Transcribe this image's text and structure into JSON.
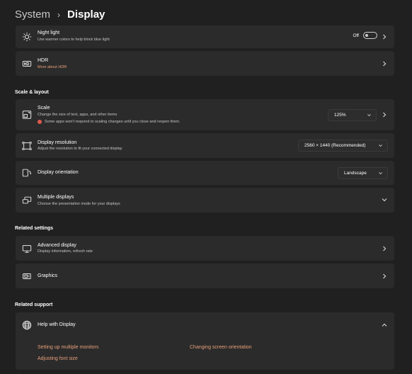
{
  "breadcrumb": {
    "parent": "System",
    "separator": "›",
    "current": "Display"
  },
  "night_light": {
    "title": "Night light",
    "subtitle": "Use warmer colors to help block blue light",
    "toggle_label": "Off"
  },
  "hdr": {
    "title": "HDR",
    "link": "More about HDR"
  },
  "scale_layout": {
    "heading": "Scale & layout",
    "scale": {
      "title": "Scale",
      "subtitle": "Change the size of text, apps, and other items",
      "warning": "Some apps won't respond to scaling changes until you close and reopen them.",
      "value": "125%"
    },
    "resolution": {
      "title": "Display resolution",
      "subtitle": "Adjust the resolution to fit your connected display",
      "value": "2560 × 1440 (Recommended)"
    },
    "orientation": {
      "title": "Display orientation",
      "value": "Landscape"
    },
    "multiple": {
      "title": "Multiple displays",
      "subtitle": "Choose the presentation mode for your displays"
    }
  },
  "related_settings": {
    "heading": "Related settings",
    "advanced": {
      "title": "Advanced display",
      "subtitle": "Display information, refresh rate"
    },
    "graphics": {
      "title": "Graphics"
    }
  },
  "related_support": {
    "heading": "Related support",
    "help": {
      "title": "Help with Display"
    },
    "links": [
      "Setting up multiple monitors",
      "Changing screen orientation",
      "Adjusting font size"
    ]
  },
  "colors": {
    "background": "#202020",
    "card": "#2b2b2b",
    "accent_link": "#e8a07a",
    "warning": "#e05a4e"
  }
}
